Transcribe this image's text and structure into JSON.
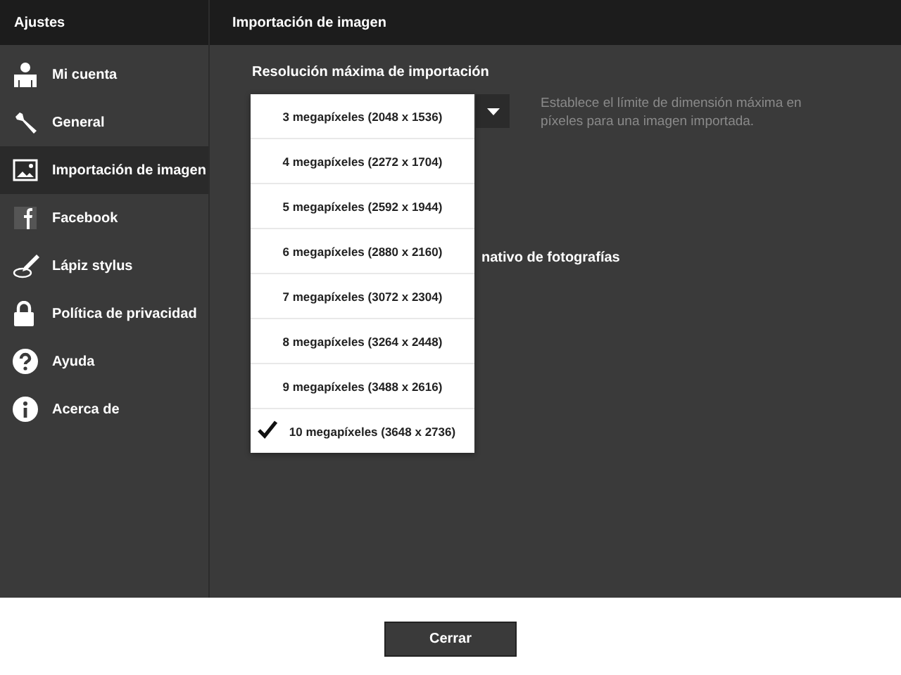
{
  "sidebar": {
    "title": "Ajustes",
    "items": [
      {
        "label": "Mi cuenta",
        "selected": false
      },
      {
        "label": "General",
        "selected": false
      },
      {
        "label": "Importación de imagen",
        "selected": true
      },
      {
        "label": "Facebook",
        "selected": false
      },
      {
        "label": "Lápiz stylus",
        "selected": false
      },
      {
        "label": "Política de privacidad",
        "selected": false
      },
      {
        "label": "Ayuda",
        "selected": false
      },
      {
        "label": "Acerca de",
        "selected": false
      }
    ]
  },
  "main": {
    "title": "Importación de imagen",
    "setting_label": "Resolución máxima de importación",
    "description": "Establece el límite de dimensión máxima en píxeles para una imagen importada.",
    "partial_label": "nativo de fotografías",
    "dropdown_options": [
      {
        "label": "3 megapíxeles (2048 x 1536)",
        "selected": false
      },
      {
        "label": "4 megapíxeles (2272 x 1704)",
        "selected": false
      },
      {
        "label": "5 megapíxeles (2592 x 1944)",
        "selected": false
      },
      {
        "label": "6 megapíxeles (2880 x 2160)",
        "selected": false
      },
      {
        "label": "7 megapíxeles (3072 x 2304)",
        "selected": false
      },
      {
        "label": "8 megapíxeles (3264 x 2448)",
        "selected": false
      },
      {
        "label": "9 megapíxeles (3488 x 2616)",
        "selected": false
      },
      {
        "label": "10 megapíxeles (3648 x 2736)",
        "selected": true
      }
    ]
  },
  "footer": {
    "button": "Cerrar"
  }
}
